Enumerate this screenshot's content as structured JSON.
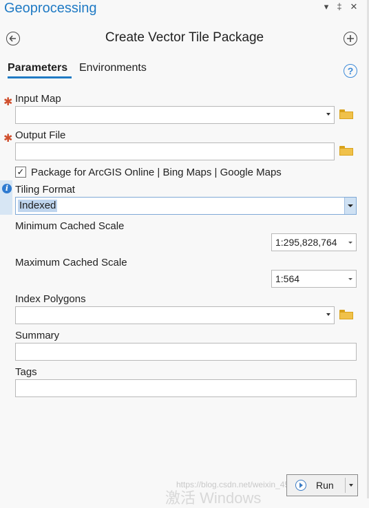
{
  "pane": {
    "title": "Geoprocessing",
    "controls": [
      "▾",
      "‡",
      "✕"
    ]
  },
  "tool": {
    "title": "Create Vector Tile Package",
    "back_icon": "back-arrow-icon",
    "add_icon": "add-icon"
  },
  "tabs": [
    {
      "label": "Parameters",
      "active": true
    },
    {
      "label": "Environments",
      "active": false
    }
  ],
  "params": {
    "input_map": {
      "label": "Input Map",
      "value": "",
      "required": true
    },
    "output_file": {
      "label": "Output File",
      "value": "",
      "required": true
    },
    "package_online": {
      "label": "Package for ArcGIS Online | Bing Maps | Google Maps",
      "checked": true
    },
    "tiling_format": {
      "label": "Tiling Format",
      "value": "Indexed"
    },
    "min_scale": {
      "label": "Minimum Cached Scale",
      "value": "1:295,828,764"
    },
    "max_scale": {
      "label": "Maximum Cached Scale",
      "value": "1:564"
    },
    "index_polygons": {
      "label": "Index Polygons",
      "value": ""
    },
    "summary": {
      "label": "Summary",
      "value": ""
    },
    "tags": {
      "label": "Tags",
      "value": ""
    }
  },
  "run": {
    "label": "Run"
  },
  "watermark": "https://blog.csdn.net/weixin_45455...",
  "activate": "激活 Windows",
  "colors": {
    "accent": "#1f7ac4",
    "required": "#d0502e",
    "selection": "#bfd5ee"
  }
}
